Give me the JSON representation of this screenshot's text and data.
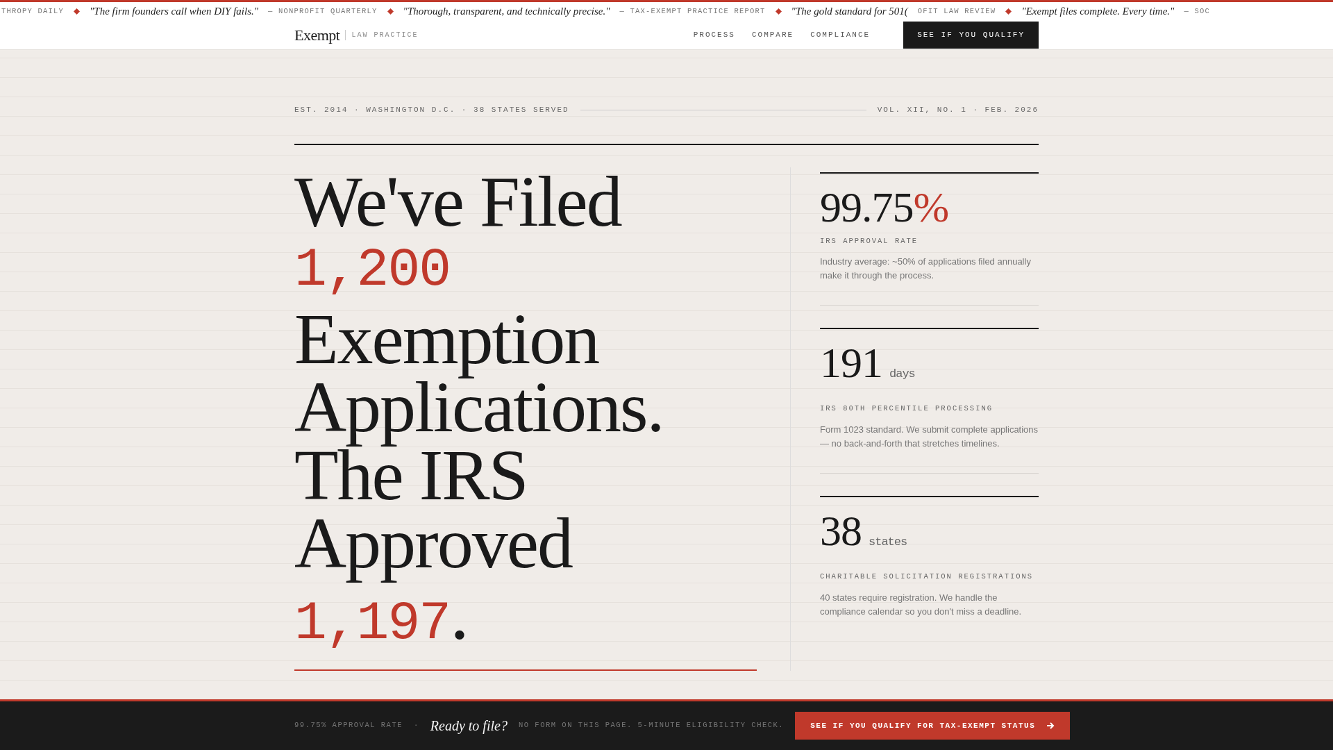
{
  "ticker": [
    {
      "kind": "source",
      "text": "THROPY DAILY"
    },
    {
      "kind": "quote",
      "text": "\"The firm founders call when DIY fails.\""
    },
    {
      "kind": "source",
      "text": "— NONPROFIT QUARTERLY"
    },
    {
      "kind": "quote",
      "text": "\"Thorough, transparent, and technically precise.\""
    },
    {
      "kind": "source",
      "text": "— TAX-EXEMPT PRACTICE REPORT"
    },
    {
      "kind": "quote",
      "text": "\"The gold standard for 501("
    },
    {
      "kind": "source",
      "text": "OFIT LAW REVIEW"
    },
    {
      "kind": "quote",
      "text": "\"Exempt files complete. Every time.\""
    },
    {
      "kind": "source",
      "text": "— SOC"
    }
  ],
  "nav": {
    "brand": "Exempt",
    "tagline": "LAW PRACTICE",
    "links": [
      "PROCESS",
      "COMPARE",
      "COMPLIANCE"
    ],
    "cta": "SEE IF YOU QUALIFY"
  },
  "meta": {
    "left": "EST. 2014 · WASHINGTON D.C. · 38 STATES SERVED",
    "right": "VOL. XII, NO. 1 · FEB. 2026"
  },
  "headline": [
    {
      "kind": "text",
      "text": "We've Filed"
    },
    {
      "kind": "number",
      "text": "1,200"
    },
    {
      "kind": "text",
      "text": "Exemption Applications. The IRS Approved"
    },
    {
      "kind": "number",
      "text": "1,197",
      "after": "."
    }
  ],
  "stats": [
    {
      "value": "99.75",
      "unit": "%",
      "kind": "percent",
      "label": "IRS APPROVAL RATE",
      "description": "Industry average: ~50% of applications filed annually make it through the process."
    },
    {
      "value": "191",
      "unit": "days",
      "kind": "unit",
      "label": "IRS 80TH PERCENTILE PROCESSING",
      "description": "Form 1023 standard. We submit complete applications — no back-and-forth that stretches timelines."
    },
    {
      "value": "38",
      "unit": "states",
      "kind": "unit",
      "label": "CHARITABLE SOLICITATION REGISTRATIONS",
      "description": "40 states require registration. We handle the compliance calendar so you don't miss a deadline."
    }
  ],
  "footer": {
    "stat": "99.75% APPROVAL RATE",
    "separator": "·",
    "tagline": "Ready to file?",
    "note": "NO FORM ON THIS PAGE. 5-MINUTE ELIGIBILITY CHECK.",
    "cta": "SEE IF YOU QUALIFY FOR TAX-EXEMPT STATUS"
  }
}
